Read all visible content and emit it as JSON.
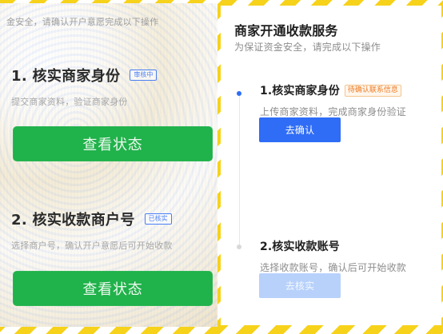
{
  "left": {
    "intro": "金安全，请确认开户意愿完成以下操作",
    "steps": [
      {
        "title": "1. 核实商家身份",
        "badge": "审核中",
        "description": "提交商家资料，验证商家身份",
        "button": "查看状态"
      },
      {
        "title": "2. 核实收款商户号",
        "badge": "已核实",
        "description": "选择商户号，确认开户意愿后可开始收款",
        "button": "查看状态"
      }
    ]
  },
  "right": {
    "title": "商家开通收款服务",
    "subtitle": "为保证资金安全，请完成以下操作",
    "steps": [
      {
        "title": "1.核实商家身份",
        "badge": "待确认联系信息",
        "description": "上传商家资料，完成商家身份验证",
        "button": "去确认"
      },
      {
        "title": "2.核实收款账号",
        "description": "选择收款账号，确认后可开始收款",
        "button": "去核实"
      }
    ]
  },
  "colors": {
    "green_button": "#20b24b",
    "blue_button": "#2f6df6",
    "light_blue_button": "#b7d1fb",
    "orange_badge": "#ec7b23",
    "stripe_yellow": "#f6d21a"
  }
}
